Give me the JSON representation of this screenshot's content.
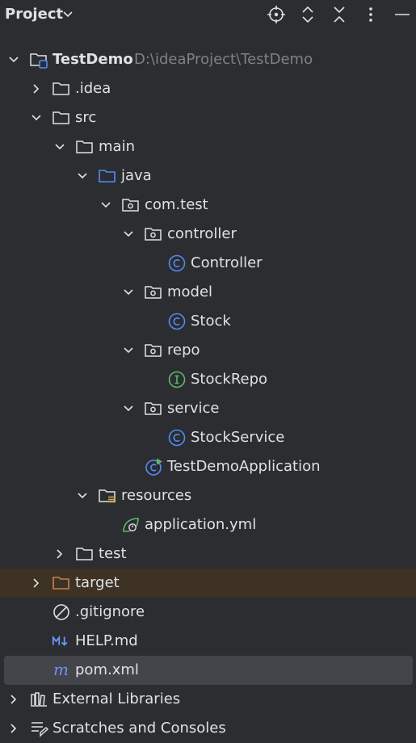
{
  "header": {
    "title": "Project",
    "icons": [
      "locate-icon",
      "expand-all-icon",
      "collapse-all-icon",
      "more-options-icon",
      "minimize-icon"
    ]
  },
  "tree": {
    "root": {
      "label": "TestDemo",
      "path": "D:\\ideaProject\\TestDemo"
    },
    "idea": ".idea",
    "src": "src",
    "main": "main",
    "java": "java",
    "com_test": "com.test",
    "controller_pkg": "controller",
    "controller_class": "Controller",
    "model_pkg": "model",
    "stock_class": "Stock",
    "repo_pkg": "repo",
    "stockrepo_iface": "StockRepo",
    "service_pkg": "service",
    "stockservice_class": "StockService",
    "app_class": "TestDemoApplication",
    "resources": "resources",
    "application_yml": "application.yml",
    "test": "test",
    "target": "target",
    "gitignore": ".gitignore",
    "help_md": "HELP.md",
    "pom_xml": "pom.xml",
    "external_libraries": "External Libraries",
    "scratches": "Scratches and Consoles"
  },
  "colors": {
    "background": "#2b2d30",
    "text": "#dfe1e5",
    "muted": "#7e8185",
    "class_icon": "#548af7",
    "interface_icon": "#5fb865",
    "target_folder": "#c77d55",
    "target_row_bg": "#3d3223",
    "selected_bg": "#43454a",
    "spring_green": "#5fb865"
  }
}
